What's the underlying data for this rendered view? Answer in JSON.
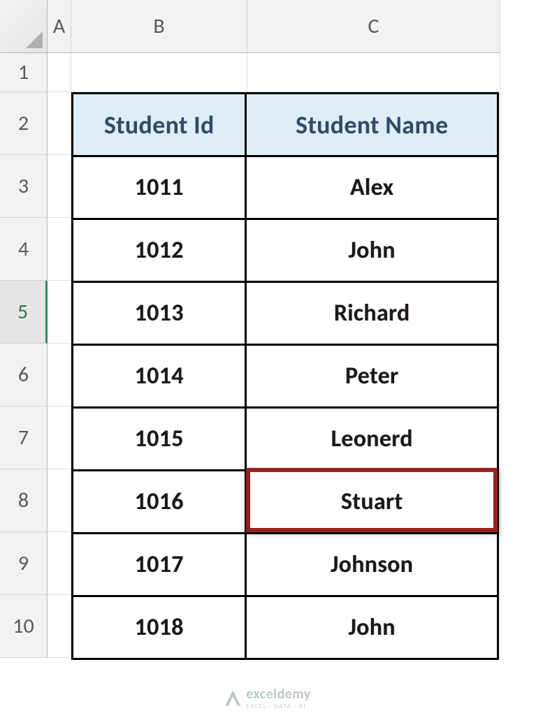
{
  "columns": [
    "A",
    "B",
    "C"
  ],
  "rows": [
    "1",
    "2",
    "3",
    "4",
    "5",
    "6",
    "7",
    "8",
    "9",
    "10"
  ],
  "active_row_index": 4,
  "table": {
    "headers": {
      "id": "Student Id",
      "name": "Student Name"
    },
    "data": [
      {
        "id": "1011",
        "name": "Alex"
      },
      {
        "id": "1012",
        "name": "John"
      },
      {
        "id": "1013",
        "name": "Richard"
      },
      {
        "id": "1014",
        "name": "Peter"
      },
      {
        "id": "1015",
        "name": "Leonerd"
      },
      {
        "id": "1016",
        "name": "Stuart"
      },
      {
        "id": "1017",
        "name": "Johnson"
      },
      {
        "id": "1018",
        "name": "John"
      }
    ],
    "highlight_row_index": 5,
    "highlight_col": "name"
  },
  "watermark": {
    "brand": "exceldemy",
    "tagline": "EXCEL · DATA · BI"
  }
}
